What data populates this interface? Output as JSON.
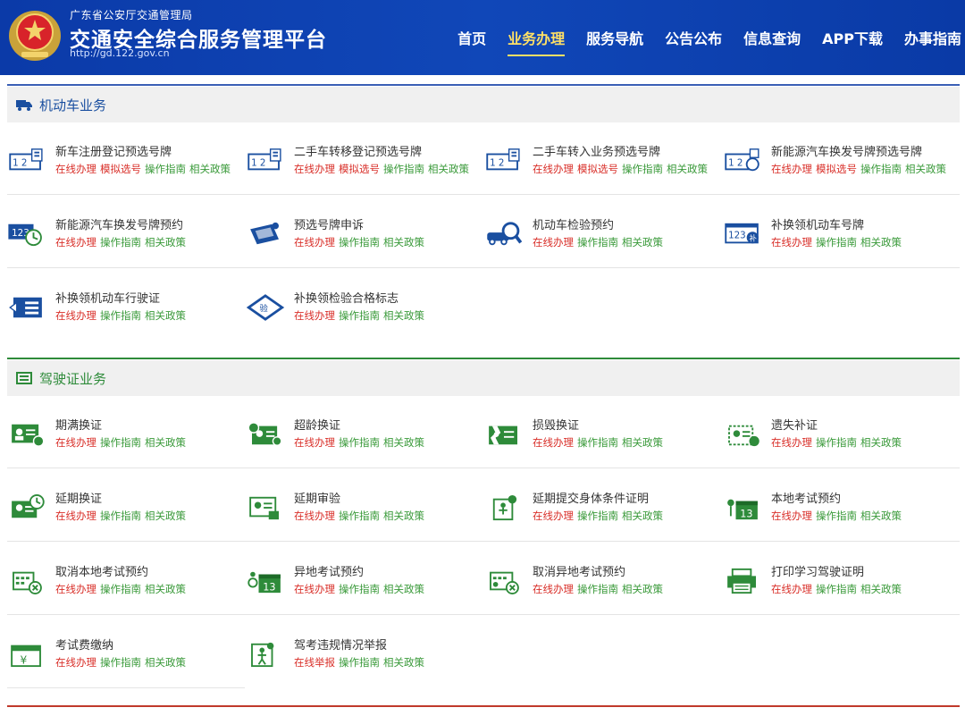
{
  "header": {
    "subtitle": "广东省公安厅交通管理局",
    "title": "交通安全综合服务管理平台",
    "url": "http://gd.122.gov.cn",
    "nav": [
      "首页",
      "业务办理",
      "服务导航",
      "公告公布",
      "信息查询",
      "APP下载",
      "办事指南"
    ],
    "active_nav": "业务办理"
  },
  "vehicle": {
    "title": "机动车业务",
    "items": [
      {
        "name": "新车注册登记预选号牌",
        "links": [
          "在线办理",
          "模拟选号",
          "操作指南",
          "相关政策"
        ]
      },
      {
        "name": "二手车转移登记预选号牌",
        "links": [
          "在线办理",
          "模拟选号",
          "操作指南",
          "相关政策"
        ]
      },
      {
        "name": "二手车转入业务预选号牌",
        "links": [
          "在线办理",
          "模拟选号",
          "操作指南",
          "相关政策"
        ]
      },
      {
        "name": "新能源汽车换发号牌预选号牌",
        "links": [
          "在线办理",
          "模拟选号",
          "操作指南",
          "相关政策"
        ]
      },
      {
        "name": "新能源汽车换发号牌预约",
        "links": [
          "在线办理",
          "操作指南",
          "相关政策"
        ]
      },
      {
        "name": "预选号牌申诉",
        "links": [
          "在线办理",
          "操作指南",
          "相关政策"
        ]
      },
      {
        "name": "机动车检验预约",
        "links": [
          "在线办理",
          "操作指南",
          "相关政策"
        ]
      },
      {
        "name": "补换领机动车号牌",
        "links": [
          "在线办理",
          "操作指南",
          "相关政策"
        ]
      },
      {
        "name": "补换领机动车行驶证",
        "links": [
          "在线办理",
          "操作指南",
          "相关政策"
        ]
      },
      {
        "name": "补换领检验合格标志",
        "links": [
          "在线办理",
          "操作指南",
          "相关政策"
        ]
      }
    ]
  },
  "license": {
    "title": "驾驶证业务",
    "items": [
      {
        "name": "期满换证",
        "links": [
          "在线办理",
          "操作指南",
          "相关政策"
        ]
      },
      {
        "name": "超龄换证",
        "links": [
          "在线办理",
          "操作指南",
          "相关政策"
        ]
      },
      {
        "name": "损毁换证",
        "links": [
          "在线办理",
          "操作指南",
          "相关政策"
        ]
      },
      {
        "name": "遗失补证",
        "links": [
          "在线办理",
          "操作指南",
          "相关政策"
        ]
      },
      {
        "name": "延期换证",
        "links": [
          "在线办理",
          "操作指南",
          "相关政策"
        ]
      },
      {
        "name": "延期审验",
        "links": [
          "在线办理",
          "操作指南",
          "相关政策"
        ]
      },
      {
        "name": "延期提交身体条件证明",
        "links": [
          "在线办理",
          "操作指南",
          "相关政策"
        ]
      },
      {
        "name": "本地考试预约",
        "links": [
          "在线办理",
          "操作指南",
          "相关政策"
        ]
      },
      {
        "name": "取消本地考试预约",
        "links": [
          "在线办理",
          "操作指南",
          "相关政策"
        ]
      },
      {
        "name": "异地考试预约",
        "links": [
          "在线办理",
          "操作指南",
          "相关政策"
        ]
      },
      {
        "name": "取消异地考试预约",
        "links": [
          "在线办理",
          "操作指南",
          "相关政策"
        ]
      },
      {
        "name": "打印学习驾驶证明",
        "links": [
          "在线办理",
          "操作指南",
          "相关政策"
        ]
      },
      {
        "name": "考试费缴纳",
        "links": [
          "在线办理",
          "操作指南",
          "相关政策"
        ]
      },
      {
        "name": "驾考违规情况举报",
        "links": [
          "在线举报",
          "操作指南",
          "相关政策"
        ]
      }
    ]
  },
  "icons": {
    "vehicle": [
      "plate-select-icon",
      "plate-select-icon",
      "plate-select-icon",
      "plate-ev-icon",
      "plate-clock-icon",
      "plate-appeal-icon",
      "car-inspect-icon",
      "plate-replace-icon",
      "vehicle-license-icon",
      "inspection-mark-icon"
    ],
    "license": [
      "license-check-icon",
      "license-age-icon",
      "license-damage-icon",
      "license-lost-icon",
      "license-clock-icon",
      "license-review-icon",
      "person-clock-icon",
      "calendar-icon",
      "calendar-cancel-icon",
      "calendar-location-icon",
      "calendar-location-cancel-icon",
      "printer-icon",
      "payment-icon",
      "person-report-icon"
    ]
  },
  "colors": {
    "header": "#0b3aa8",
    "active_nav": "#ffe066",
    "link_red": "#d9302a",
    "link_green": "#3a9a3a",
    "vehicle_icon": "#1a4fa0",
    "license_icon": "#2e8b3a"
  }
}
